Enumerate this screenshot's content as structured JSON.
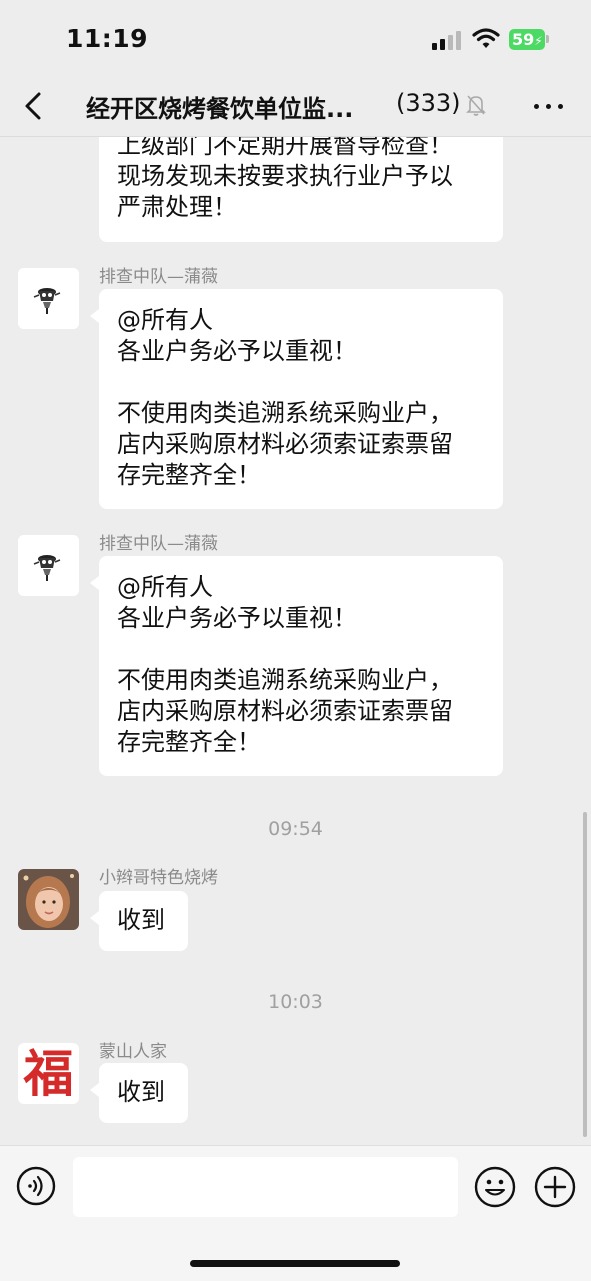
{
  "status_bar": {
    "time": "11:19",
    "battery": "59"
  },
  "header": {
    "title": "经开区烧烤餐饮单位监...",
    "member_count": "(333)"
  },
  "messages": [
    {
      "lines": [
        "上级部门不定期开展督导检查！",
        "现场发现未按要求执行业户予以",
        "严肃处理！"
      ]
    },
    {
      "sender": "排查中队—蒲薇",
      "lines": [
        "@所有人",
        "各业户务必予以重视！",
        "",
        "不使用肉类追溯系统采购业户，",
        "店内采购原材料必须索证索票留",
        "存完整齐全！"
      ]
    },
    {
      "sender": "排查中队—蒲薇",
      "lines": [
        "@所有人",
        "各业户务必予以重视！",
        "",
        "不使用肉类追溯系统采购业户，",
        "店内采购原材料必须索证索票留",
        "存完整齐全！"
      ]
    },
    {
      "timestamp": "09:54"
    },
    {
      "sender": "小辫哥特色烧烤",
      "lines": [
        "收到"
      ]
    },
    {
      "timestamp": "10:03"
    },
    {
      "sender": "蒙山人家",
      "lines": [
        "收到"
      ],
      "avatar_glyph": "福"
    }
  ],
  "icons": {
    "back": "chevron-left-icon",
    "mute": "bell-off-icon",
    "more": "more-icon",
    "voice": "voice-icon",
    "emoji": "emoji-icon",
    "plus": "plus-icon"
  },
  "colors": {
    "background": "#ededed",
    "bubble": "#ffffff",
    "battery": "#4cd964",
    "fu": "#d42a2a"
  }
}
